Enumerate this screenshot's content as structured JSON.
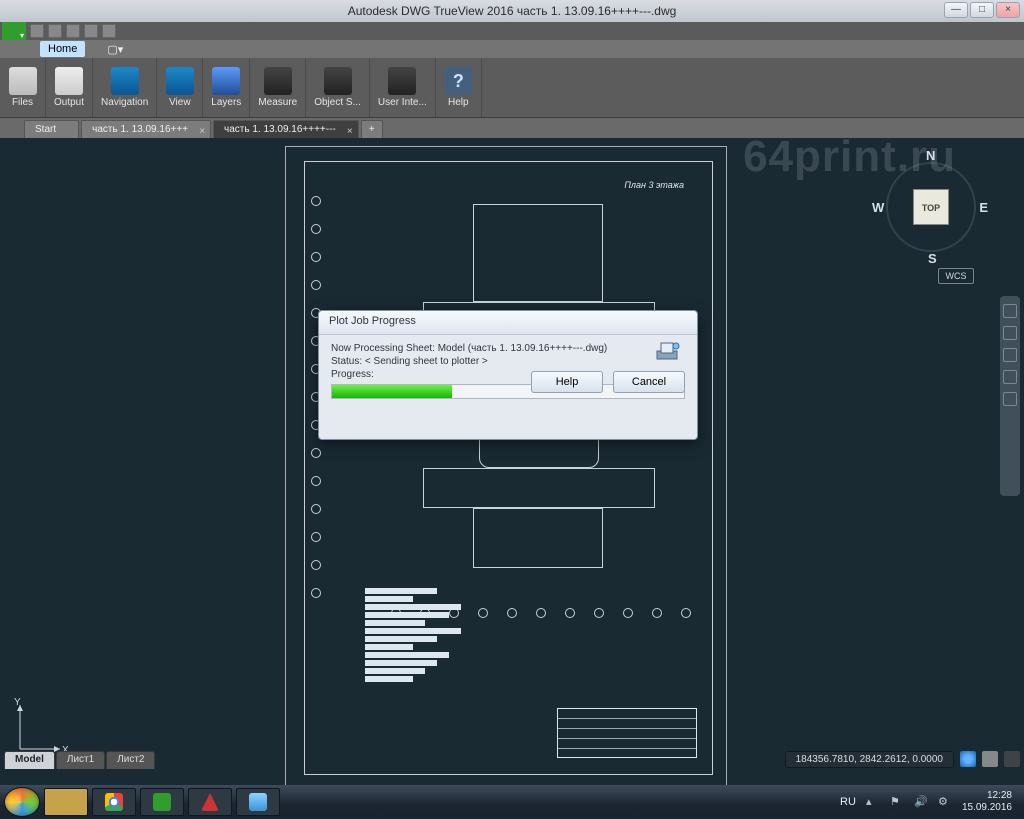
{
  "window": {
    "title": "Autodesk DWG TrueView 2016     часть 1. 13.09.16++++---.dwg",
    "controls": {
      "min": "—",
      "max": "□",
      "close": "×"
    }
  },
  "menu": {
    "home": "Home",
    "extra": "▢▾"
  },
  "ribbon": {
    "files": "Files",
    "output": "Output",
    "navigation": "Navigation",
    "view": "View",
    "layers": "Layers",
    "measure": "Measure",
    "objsnap": "Object S...",
    "userint": "User Inte...",
    "help": "Help",
    "help_glyph": "?"
  },
  "tabs": {
    "start": "Start",
    "t1": "часть 1. 13.09.16+++",
    "t2": "часть 1. 13.09.16++++---",
    "add": "+"
  },
  "canvas": {
    "plan_label": "План 3 этажа",
    "watermark": "64print.ru",
    "ucs_x": "X",
    "ucs_y": "Y",
    "viewcube": {
      "top": "TOP",
      "n": "N",
      "s": "S",
      "e": "E",
      "w": "W"
    },
    "wcs": "WCS"
  },
  "dialog": {
    "title": "Plot Job Progress",
    "processing": "Now Processing Sheet: Model (часть 1. 13.09.16++++---.dwg)",
    "status": "Status: < Sending sheet to plotter >",
    "progress_label": "Progress:",
    "help": "Help",
    "cancel": "Cancel"
  },
  "model_tabs": {
    "model": "Model",
    "sheet1": "Лист1",
    "sheet2": "Лист2"
  },
  "status": {
    "coords": "184356.7810, 2842.2612, 0.0000"
  },
  "taskbar": {
    "lang": "RU",
    "time": "12:28",
    "date": "15.09.2016",
    "tray_up": "▴"
  }
}
